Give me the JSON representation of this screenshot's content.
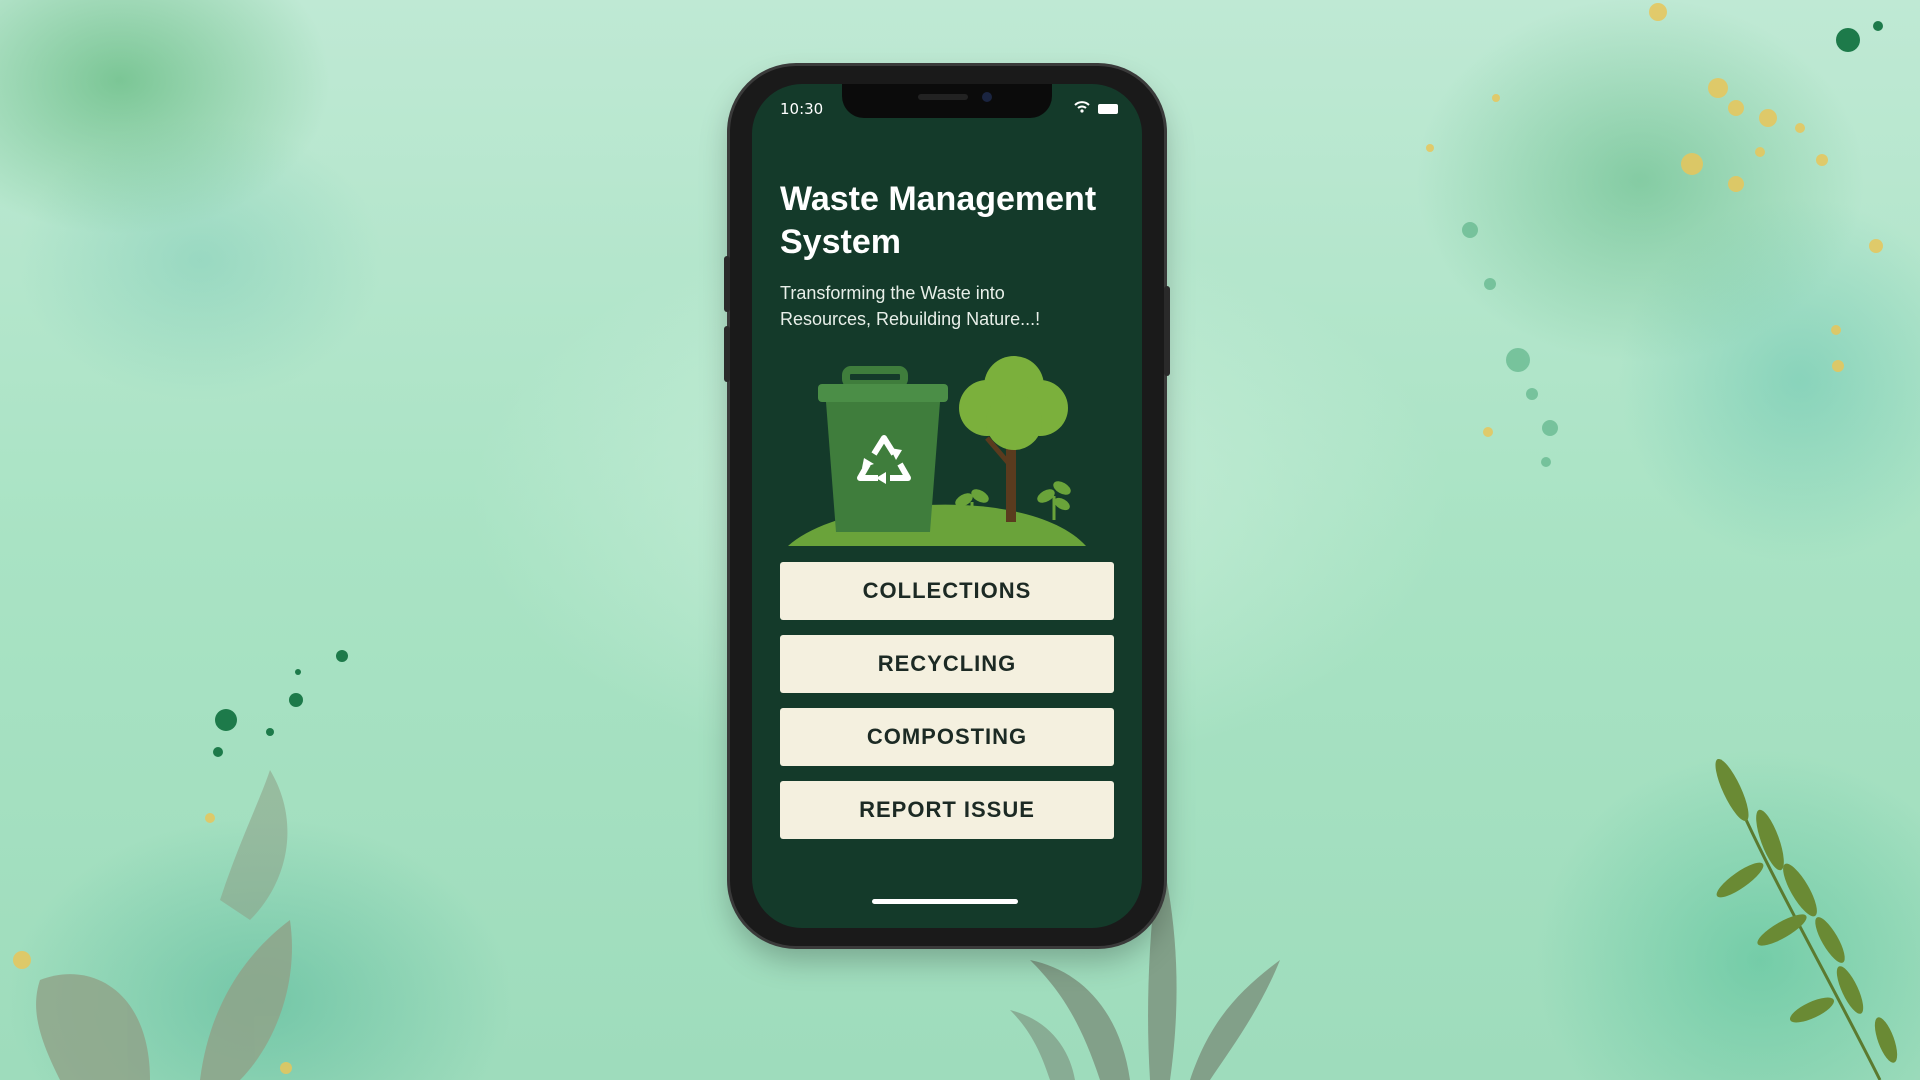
{
  "status_bar": {
    "time": "10:30"
  },
  "app": {
    "title": "Waste Management System",
    "subtitle": "Transforming the Waste into Resources, Rebuilding Nature...!"
  },
  "buttons": [
    {
      "label": "COLLECTIONS"
    },
    {
      "label": "RECYCLING"
    },
    {
      "label": "COMPOSTING"
    },
    {
      "label": "REPORT ISSUE"
    }
  ],
  "icons": {
    "wifi": "wifi-icon",
    "battery": "battery-icon",
    "illustration": "recycle-bin-tree-illustration"
  },
  "colors": {
    "screen_background": "#143a2a",
    "button_background": "#f4f0df",
    "button_text": "#1c2a24",
    "bin_green": "#3f7d3c",
    "grass_green": "#6aa33a",
    "page_background": "#a9e3c4"
  }
}
